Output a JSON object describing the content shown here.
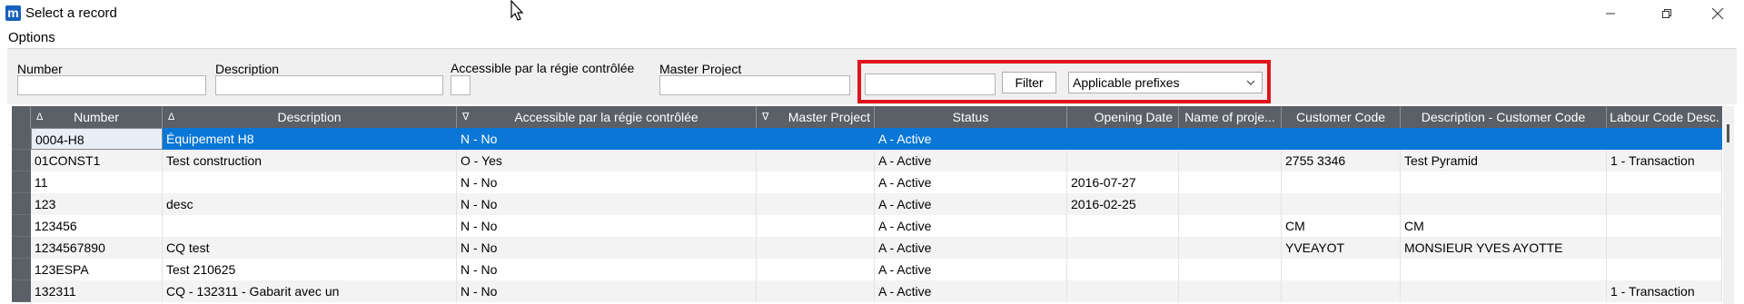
{
  "window": {
    "app_icon_letter": "m",
    "title": "Select a record"
  },
  "menu": {
    "options": "Options"
  },
  "filters": {
    "number_label": "Number",
    "description_label": "Description",
    "accessible_label": "Accessible par la régie contrôlée",
    "master_project_label": "Master Project",
    "number_value": "",
    "description_value": "",
    "accessible_value": "",
    "master_project_value": "",
    "search_value": "",
    "filter_button": "Filter",
    "prefix_select": "Applicable prefixes"
  },
  "grid": {
    "columns": [
      "Number",
      "Description",
      "Accessible par la régie contrôlée",
      "Master Project",
      "Status",
      "Opening Date",
      "Name of proje...",
      "Customer Code",
      "Description - Customer Code",
      "Labour Code Desc."
    ],
    "sort_icons": [
      "Δ",
      "Δ",
      "∇",
      "∇"
    ],
    "rows": [
      [
        "0004-H8",
        "Équipement H8",
        "N - No",
        "",
        "A - Active",
        "",
        "",
        "",
        "",
        ""
      ],
      [
        "01CONST1",
        "Test construction",
        "O - Yes",
        "",
        "A - Active",
        "",
        "",
        "2755 3346",
        "Test Pyramid",
        "1 - Transaction"
      ],
      [
        "11",
        "",
        "N - No",
        "",
        "A - Active",
        "2016-07-27",
        "",
        "",
        "",
        ""
      ],
      [
        "123",
        "desc",
        "N - No",
        "",
        "A - Active",
        "2016-02-25",
        "",
        "",
        "",
        ""
      ],
      [
        "123456",
        "",
        "N - No",
        "",
        "A - Active",
        "",
        "",
        "CM",
        "CM",
        ""
      ],
      [
        "1234567890",
        "CQ test",
        "N - No",
        "",
        "A - Active",
        "",
        "",
        "YVEAYOT",
        "MONSIEUR YVES AYOTTE",
        ""
      ],
      [
        "123ESPA",
        "Test 210625",
        "N - No",
        "",
        "A - Active",
        "",
        "",
        "",
        "",
        ""
      ],
      [
        "132311",
        "CQ - 132311 - Gabarit avec un",
        "N - No",
        "",
        "A - Active",
        "",
        "",
        "",
        "",
        "1 - Transaction"
      ]
    ]
  }
}
